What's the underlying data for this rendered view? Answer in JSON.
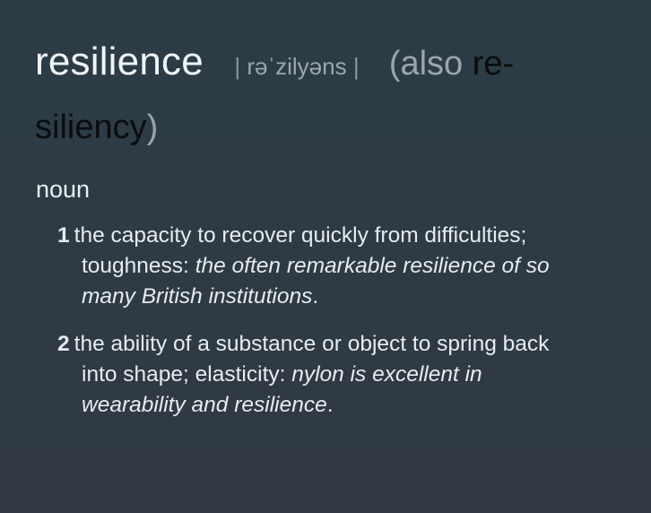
{
  "entry": {
    "headword": "resilience",
    "pronunciation": "rəˈzilyəns",
    "pron_bar": "|",
    "also_open": "(also ",
    "also_word_part1": "re-",
    "also_word_part2": "siliency",
    "also_close": ")"
  },
  "part_of_speech": "noun",
  "senses": [
    {
      "number": "1",
      "line1": "the capacity to recover quickly from difficulties;",
      "line2_def": "toughness: ",
      "line2_example": "the often remarkable resilience of so",
      "line3_example": "many British institutions",
      "line3_end": "."
    },
    {
      "number": "2",
      "line1": "the ability of a substance or object to spring back",
      "line2_def": "into shape; elasticity: ",
      "line2_example": "nylon is excellent in",
      "line3_example": "wearability and resilience",
      "line3_end": "."
    }
  ]
}
